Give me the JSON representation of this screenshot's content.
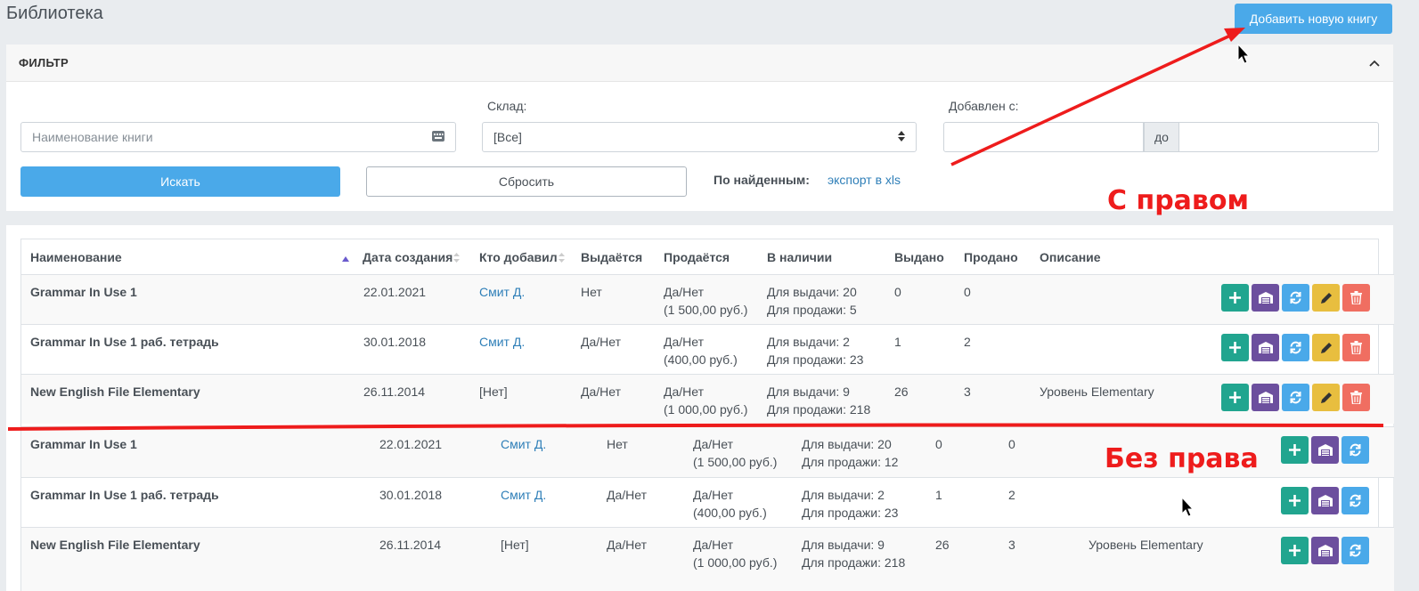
{
  "page": {
    "title": "Библиотека"
  },
  "header": {
    "add_button": "Добавить новую книгу"
  },
  "filter": {
    "title": "ФИЛЬТР",
    "name_placeholder": "Наименование книги",
    "warehouse_label": "Склад:",
    "warehouse_value": "[Все]",
    "added_label": "Добавлен с:",
    "date_separator": "до",
    "search_button": "Искать",
    "reset_button": "Сбросить",
    "found_label": "По найденным:",
    "export_link": "экспорт в xls"
  },
  "table": {
    "columns": [
      "Наименование",
      "Дата создания",
      "Кто добавил",
      "Выдаётся",
      "Продаётся",
      "В наличии",
      "Выдано",
      "Продано",
      "Описание"
    ],
    "rows_with_right": [
      {
        "name": "Grammar In Use 1",
        "date": "22.01.2021",
        "added_by": "Смит Д.",
        "issued": "Нет",
        "sold_line1": "Да/Нет",
        "sold_line2": "(1 500,00 руб.)",
        "stock_line1": "Для выдачи: 20",
        "stock_line2": "Для продажи: 5",
        "given": "0",
        "sold_count": "0",
        "description": ""
      },
      {
        "name": "Grammar In Use 1 раб. тетрадь",
        "date": "30.01.2018",
        "added_by": "Смит Д.",
        "issued": "Да/Нет",
        "sold_line1": "Да/Нет",
        "sold_line2": "(400,00 руб.)",
        "stock_line1": "Для выдачи: 2",
        "stock_line2": "Для продажи: 23",
        "given": "1",
        "sold_count": "2",
        "description": ""
      },
      {
        "name": "New English File Elementary",
        "date": "26.11.2014",
        "added_by": "[Нет]",
        "issued": "Да/Нет",
        "sold_line1": "Да/Нет",
        "sold_line2": "(1 000,00 руб.)",
        "stock_line1": "Для выдачи: 9",
        "stock_line2": "Для продажи: 218",
        "given": "26",
        "sold_count": "3",
        "description": "Уровень Elementary"
      }
    ],
    "rows_without_right": [
      {
        "name": "Grammar In Use 1",
        "date": "22.01.2021",
        "added_by": "Смит Д.",
        "issued": "Нет",
        "sold_line1": "Да/Нет",
        "sold_line2": "(1 500,00 руб.)",
        "stock_line1": "Для выдачи: 20",
        "stock_line2": "Для продажи: 12",
        "given": "0",
        "sold_count": "0",
        "description": ""
      },
      {
        "name": "Grammar In Use 1 раб. тетрадь",
        "date": "30.01.2018",
        "added_by": "Смит Д.",
        "issued": "Да/Нет",
        "sold_line1": "Да/Нет",
        "sold_line2": "(400,00 руб.)",
        "stock_line1": "Для выдачи: 2",
        "stock_line2": "Для продажи: 23",
        "given": "1",
        "sold_count": "2",
        "description": ""
      },
      {
        "name": "New English File Elementary",
        "date": "26.11.2014",
        "added_by": "[Нет]",
        "issued": "Да/Нет",
        "sold_line1": "Да/Нет",
        "sold_line2": "(1 000,00 руб.)",
        "stock_line1": "Для выдачи: 9",
        "stock_line2": "Для продажи: 218",
        "given": "26",
        "sold_count": "3",
        "description": "Уровень Elementary"
      }
    ]
  },
  "annotations": {
    "with_right": "С правом",
    "without_right": "Без права"
  },
  "icons": {
    "add": "plus-icon",
    "warehouse": "warehouse-icon",
    "swap": "refresh-icon",
    "edit": "pencil-icon",
    "delete": "trash-icon",
    "collapse": "chevron-up-icon",
    "keyboard": "keyboard-icon",
    "select": "select-arrows-icon",
    "sort": "sort-icon"
  },
  "colors": {
    "primary": "#4aa9e9",
    "add": "#21a58f",
    "warehouse": "#6c4f9e",
    "edit": "#e8be3f",
    "delete": "#f06e61",
    "link": "#2f7fb8",
    "annotation": "#ee1c1c"
  }
}
